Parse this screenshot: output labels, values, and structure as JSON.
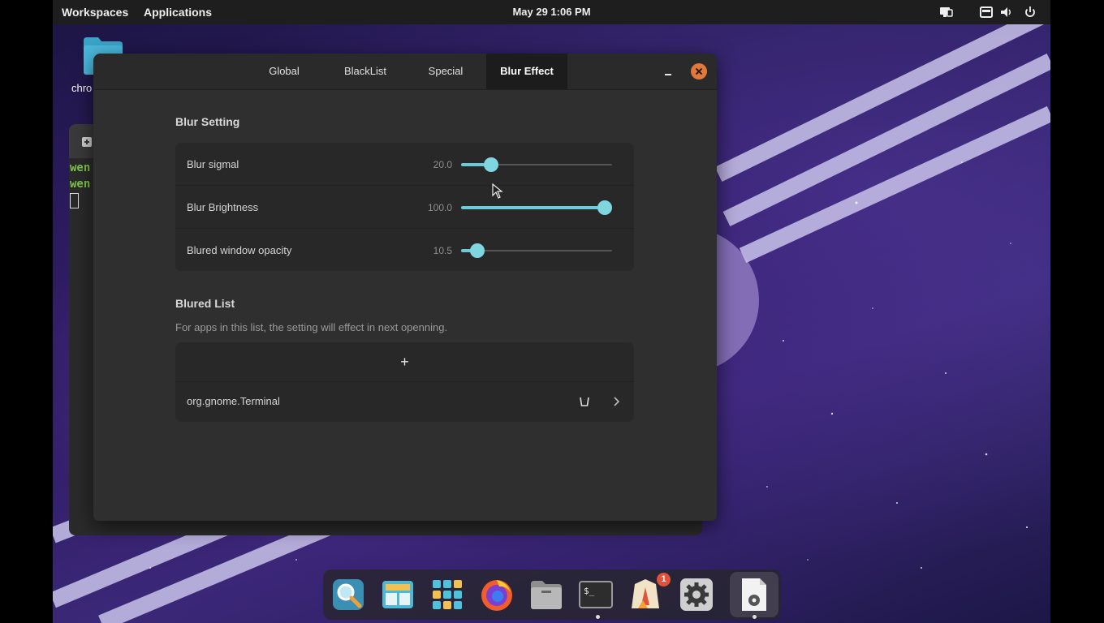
{
  "topbar": {
    "workspaces": "Workspaces",
    "applications": "Applications",
    "clock": "May 29   1:06 PM"
  },
  "desktop": {
    "folder_label": "chro"
  },
  "terminal_bg": {
    "line1": "wen",
    "line2": "wen"
  },
  "window": {
    "tabs": [
      "Global",
      "BlackList",
      "Special",
      "Blur Effect"
    ],
    "active_tab": "Blur Effect",
    "blur_setting_title": "Blur Setting",
    "sliders": [
      {
        "label": "Blur sigmal",
        "value_text": "20.0",
        "fraction": 0.2
      },
      {
        "label": "Blur Brightness",
        "value_text": "100.0",
        "fraction": 1.0
      },
      {
        "label": "Blured window opacity",
        "value_text": "10.5",
        "fraction": 0.105
      }
    ],
    "blured_list_title": "Blured List",
    "blured_list_desc": "For apps in this list, the setting will effect in next openning.",
    "add_symbol": "+",
    "list_items": [
      "org.gnome.Terminal"
    ]
  },
  "dock": {
    "items": [
      "search-app-icon",
      "multitasking-icon",
      "app-grid-icon",
      "firefox-icon",
      "files-icon",
      "terminal-icon",
      "launcher-icon",
      "settings-icon",
      "text-editor-icon"
    ],
    "badge_count": "1"
  },
  "colors": {
    "accent": "#7fd6e0",
    "close": "#e1793b",
    "window_bg": "#2f2f2f",
    "card_bg": "#282828"
  }
}
